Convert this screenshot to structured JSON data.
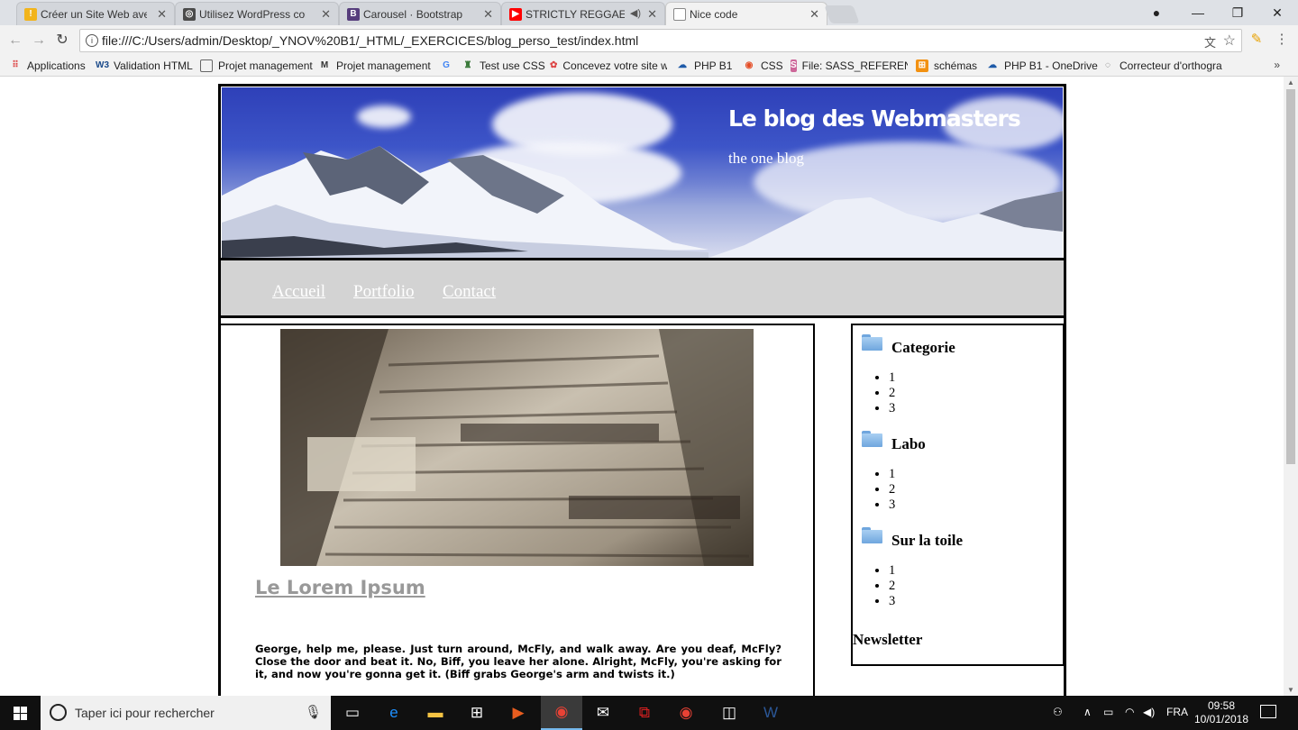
{
  "browser": {
    "tabs": [
      {
        "label": "Créer un Site Web avec W",
        "icon": "warning-icon",
        "color": "#f2b41b"
      },
      {
        "label": "Utilisez WordPress comm",
        "icon": "openclassrooms-icon",
        "color": "#4b4b4b"
      },
      {
        "label": "Carousel · Bootstrap",
        "icon": "bootstrap-icon",
        "color": "#563d7c"
      },
      {
        "label": "STRICTLY REGGAE RO",
        "icon": "youtube-icon",
        "color": "#ff0000"
      },
      {
        "label": "Nice code",
        "icon": "document-icon",
        "color": "#888888"
      }
    ],
    "url": "file:///C:/Users/admin/Desktop/_YNOV%20B1/_HTML/_EXERCICES/blog_perso_test/index.html",
    "bookmarks": [
      {
        "label": "Applications",
        "icon": "apps-grid-icon"
      },
      {
        "label": "Validation HTML",
        "icon": "w3c-icon"
      },
      {
        "label": "Projet management",
        "icon": "page-icon"
      },
      {
        "label": "Projet management",
        "icon": "mi-icon"
      },
      {
        "label": "",
        "icon": "google-icon"
      },
      {
        "label": "Test use CSS",
        "icon": "tool-icon"
      },
      {
        "label": "Concevez votre site w",
        "icon": "openclassrooms-icon"
      },
      {
        "label": "PHP B1",
        "icon": "onedrive-icon"
      },
      {
        "label": "CSS",
        "icon": "css-icon"
      },
      {
        "label": "File: SASS_REFERENCE",
        "icon": "sass-icon"
      },
      {
        "label": "schémas",
        "icon": "schema-icon"
      },
      {
        "label": "PHP B1 - OneDrive",
        "icon": "onedrive-icon"
      },
      {
        "label": "Correcteur d'orthogra",
        "icon": "spell-icon"
      }
    ],
    "more": "»"
  },
  "site": {
    "title": "Le blog des Webmasters",
    "subtitle": "the one blog",
    "nav": [
      "Accueil",
      "Portfolio",
      "Contact"
    ],
    "post": {
      "title": "Le Lorem Ipsum",
      "body": "George, help me, please. Just turn around, McFly, and walk away. Are you deaf, McFly? Close the door and beat it. No, Biff, you leave her alone. Alright, McFly, you're asking for it, and now you're gonna get it. (Biff grabs George's arm and twists it.)"
    },
    "sidebar": [
      {
        "heading": "Categorie",
        "items": [
          "1",
          "2",
          "3"
        ]
      },
      {
        "heading": "Labo",
        "items": [
          "1",
          "2",
          "3"
        ]
      },
      {
        "heading": "Sur la toile",
        "items": [
          "1",
          "2",
          "3"
        ]
      }
    ],
    "newsletter": "Newsletter"
  },
  "taskbar": {
    "search_placeholder": "Taper ici pour rechercher",
    "language": "FRA",
    "time": "09:58",
    "date": "10/01/2018"
  }
}
